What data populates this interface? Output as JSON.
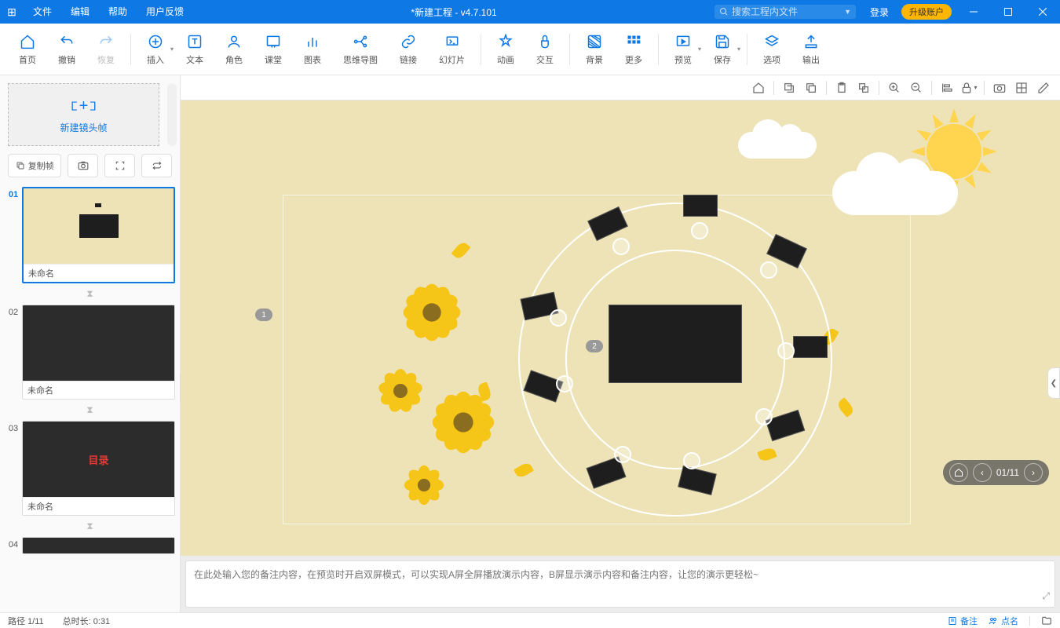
{
  "titlebar": {
    "title": "*新建工程 - v4.7.101",
    "menu": [
      "文件",
      "编辑",
      "帮助",
      "用户反馈"
    ],
    "search_placeholder": "搜索工程内文件",
    "login": "登录",
    "upgrade": "升级账户"
  },
  "toolbar": {
    "home": "首页",
    "undo": "撤销",
    "redo": "恢复",
    "insert": "插入",
    "text": "文本",
    "role": "角色",
    "class": "课堂",
    "chart": "图表",
    "mindmap": "思维导图",
    "link": "链接",
    "slide": "幻灯片",
    "animation": "动画",
    "interact": "交互",
    "background": "背景",
    "more": "更多",
    "preview": "预览",
    "save": "保存",
    "options": "选项",
    "output": "输出"
  },
  "sidebar": {
    "new_frame": "新建镜头帧",
    "copy_frame": "复制帧",
    "slides": [
      {
        "num": "01",
        "label": "未命名"
      },
      {
        "num": "02",
        "label": "未命名"
      },
      {
        "num": "03",
        "label": "未命名"
      },
      {
        "num": "04",
        "label": ""
      }
    ]
  },
  "canvas": {
    "marker1": "1",
    "marker2": "2",
    "toc_title": "目录"
  },
  "nav": {
    "counter": "01/11"
  },
  "notes": {
    "placeholder": "在此处输入您的备注内容，在预览时开启双屏模式，可以实现A屏全屏播放演示内容，B屏显示演示内容和备注内容，让您的演示更轻松~"
  },
  "status": {
    "path": "路径 1/11",
    "duration": "总时长: 0:31",
    "notes_btn": "备注",
    "roll_btn": "点名"
  }
}
